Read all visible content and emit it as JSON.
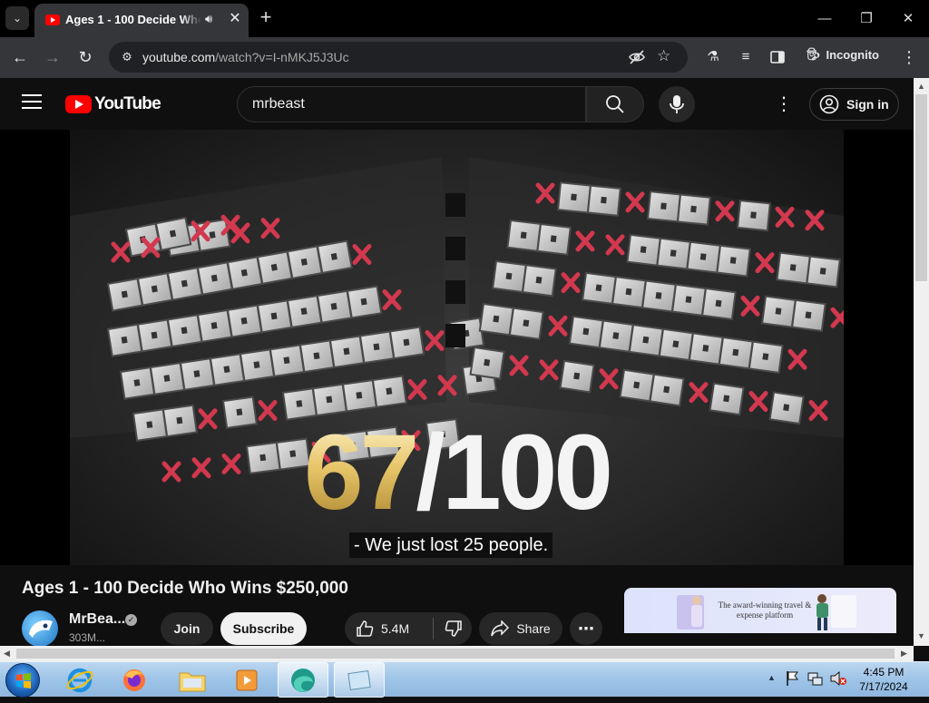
{
  "browser": {
    "tab_title": "Ages 1 - 100 Decide Who Wins $250,000",
    "tab_list_icon": "chevron-down",
    "new_tab_label": "+",
    "window_controls": {
      "minimize": "—",
      "restore": "❐",
      "close": "✕"
    },
    "url_host": "youtube.com",
    "url_path": "/watch?v=I-nMKJ5J3Uc",
    "incognito_label": "Incognito"
  },
  "youtube": {
    "logo_text": "YouTube",
    "search_value": "mrbeast",
    "signin_label": "Sign in",
    "brand_color": "#ff0000"
  },
  "video": {
    "score_number": "67",
    "score_rest": "/100",
    "caption": "- We just lost 25 people."
  },
  "details": {
    "title": "Ages 1 - 100 Decide Who Wins $250,000",
    "channel_name": "MrBea...",
    "subscribers": "303M...",
    "join_label": "Join",
    "subscribe_label": "Subscribe",
    "likes": "5.4M",
    "share_label": "Share",
    "ad_text": "The award-winning travel & expense platform"
  },
  "taskbar": {
    "time": "4:45 PM",
    "date": "7/17/2024"
  }
}
